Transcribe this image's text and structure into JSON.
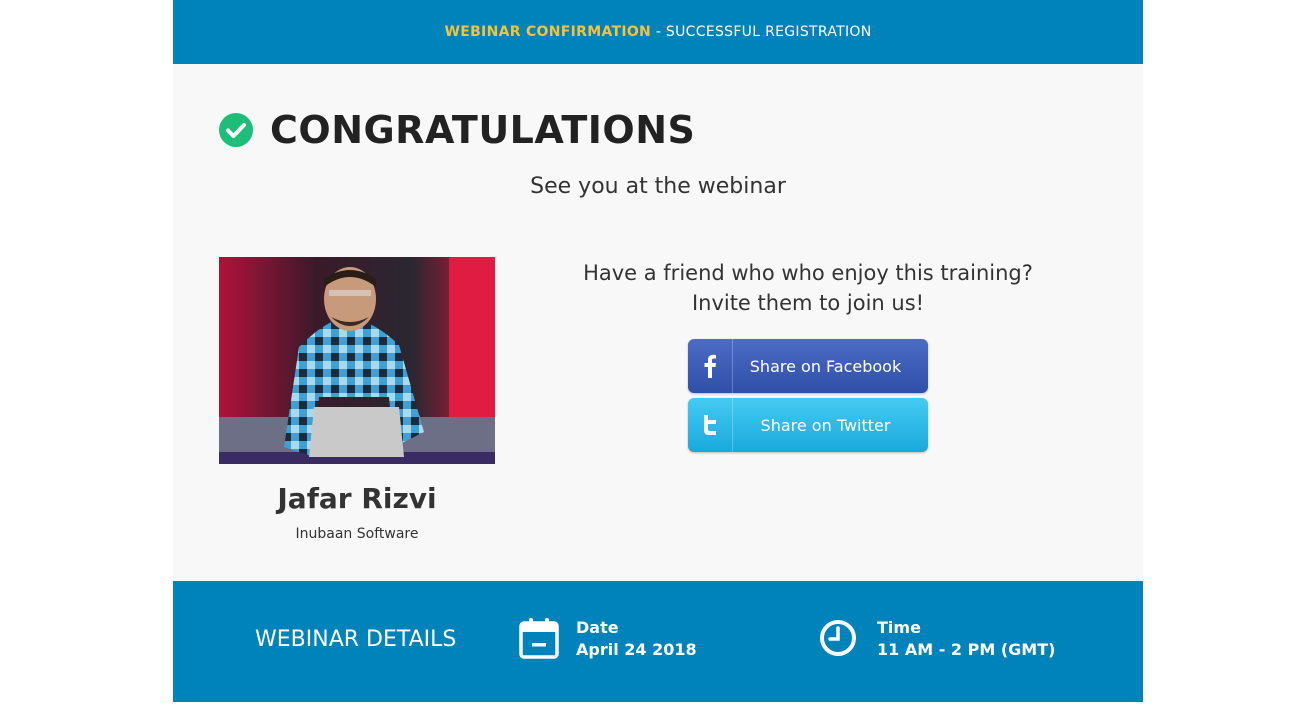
{
  "banner": {
    "accent": "WEBINAR CONFIRMATION",
    "rest": " - SUCCESSFUL REGISTRATION"
  },
  "hero": {
    "title": "CONGRATULATIONS",
    "subtitle": "See you at the webinar"
  },
  "presenter": {
    "name": "Jafar Rizvi",
    "company": "Inubaan Software"
  },
  "invite": {
    "line1": "Have a friend who who enjoy this training?",
    "line2": "Invite them to join us!"
  },
  "share": {
    "facebook": "Share on Facebook",
    "twitter": "Share on Twitter"
  },
  "footer": {
    "heading": "WEBINAR DETAILS",
    "date_label": "Date",
    "date_value": "April 24 2018",
    "time_label": "Time",
    "time_value": "11 AM - 2 PM (GMT)"
  },
  "colors": {
    "brand": "#0082ba",
    "accent": "#f5c33b",
    "success": "#1ebd7a",
    "facebook": "#3b5bb5",
    "twitter": "#29b6e8"
  },
  "icons": [
    "check-circle-icon",
    "facebook-icon",
    "twitter-icon",
    "calendar-icon",
    "clock-icon"
  ]
}
